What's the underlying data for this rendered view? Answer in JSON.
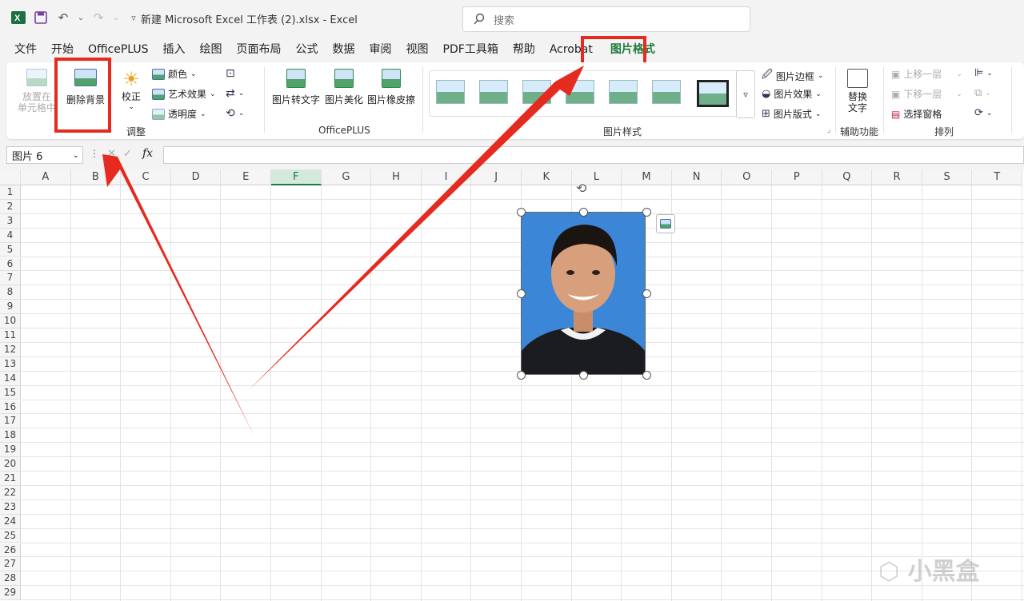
{
  "titlebar": {
    "doc_title": "新建 Microsoft Excel 工作表 (2).xlsx  -  Excel",
    "search_placeholder": "搜索",
    "qat_icons": [
      "excel-logo-icon",
      "save-icon",
      "undo-icon",
      "redo-icon",
      "customize-qat-icon"
    ]
  },
  "menu": {
    "tabs": [
      "文件",
      "开始",
      "OfficePLUS",
      "插入",
      "绘图",
      "页面布局",
      "公式",
      "数据",
      "审阅",
      "视图",
      "PDF工具箱",
      "帮助",
      "Acrobat",
      "图片格式"
    ],
    "active_tab": "图片格式"
  },
  "ribbon": {
    "adjust": {
      "place_in_cell": "放置在\n单元格中",
      "remove_bg": "删除背景",
      "correct": "校正",
      "color": "颜色",
      "art_effects": "艺术效果",
      "transparency": "透明度",
      "group_label": "调整"
    },
    "officeplus": {
      "pic_to_text": "图片转文字",
      "pic_beautify": "图片美化",
      "pic_eraser": "图片橡皮擦",
      "group_label": "OfficePLUS"
    },
    "styles": {
      "group_label": "图片样式"
    },
    "style_options": {
      "border": "图片边框",
      "effects": "图片效果",
      "layout": "图片版式"
    },
    "accessibility": {
      "alt_text": "替换\n文字",
      "group_label": "辅助功能"
    },
    "arrange": {
      "bring_forward": "上移一层",
      "send_backward": "下移一层",
      "selection_pane": "选择窗格",
      "group_label": "排列"
    }
  },
  "formula_bar": {
    "name_box": "图片 6",
    "fx": "fx"
  },
  "sheet": {
    "columns": [
      "A",
      "B",
      "C",
      "D",
      "E",
      "F",
      "G",
      "H",
      "I",
      "J",
      "K",
      "L",
      "M",
      "N",
      "O",
      "P",
      "Q",
      "R",
      "S",
      "T"
    ],
    "rows": [
      "1",
      "2",
      "3",
      "4",
      "5",
      "6",
      "7",
      "8",
      "9",
      "10",
      "11",
      "12",
      "13",
      "14",
      "15",
      "16",
      "17",
      "18",
      "19",
      "20",
      "21",
      "22",
      "23",
      "24",
      "25",
      "26",
      "27",
      "28",
      "29"
    ],
    "selected_column": "F"
  },
  "watermark": "小黑盒",
  "colors": {
    "accent_green": "#1f7a3e",
    "annotation_red": "#e52a1f",
    "photo_bg": "#3b86d6"
  }
}
